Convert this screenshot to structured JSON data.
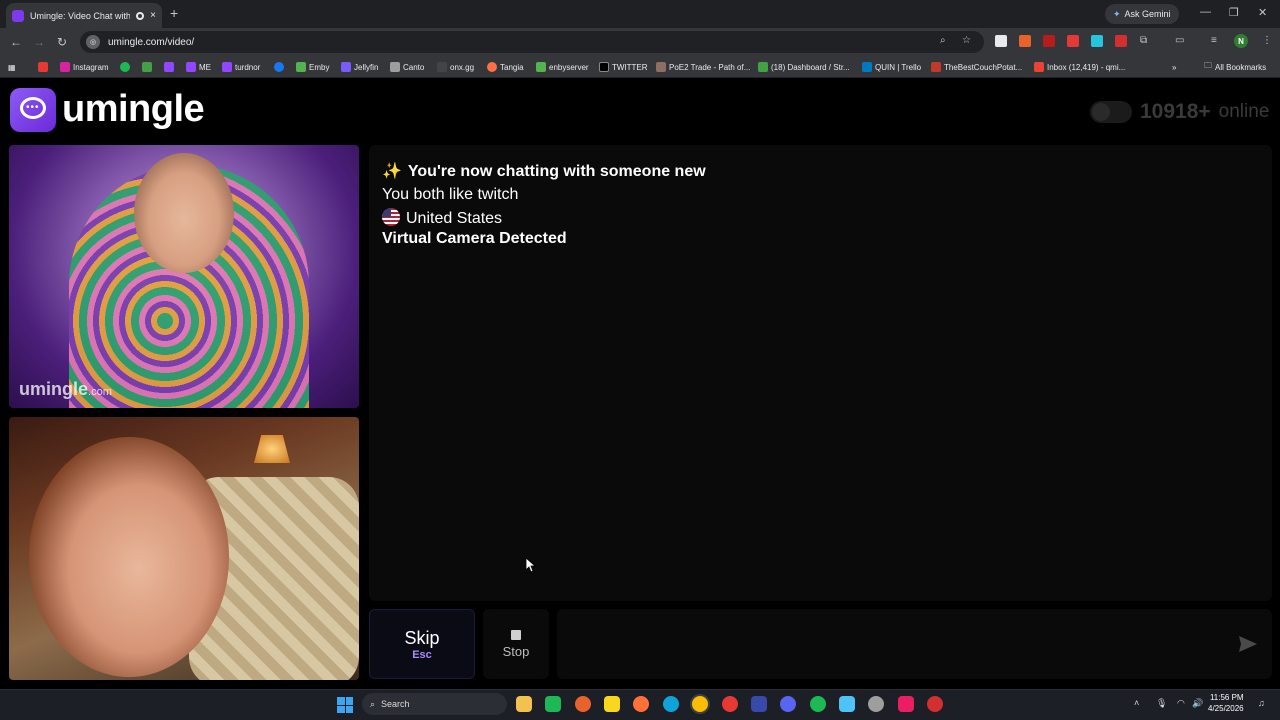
{
  "browser": {
    "tab_title": "Umingle: Video Chat with S",
    "tab_close": "×",
    "new_tab": "+",
    "ask_gemini": "Ask Gemini",
    "url": "umingle.com/video/",
    "bookmarks": [
      "Instagram",
      "ME",
      "turdnor",
      "Emby",
      "Jellyfin",
      "Canto",
      "onx.gg",
      "Tangia",
      "enbyserver",
      "TWITTER",
      "PoE2 Trade - Path of...",
      "(18) Dashboard / Str...",
      "QUIN | Trello",
      "TheBestCouchPotat...",
      "Inbox (12,419) - qmi..."
    ],
    "all_bookmarks": "All Bookmarks",
    "profile_initial": "N"
  },
  "site": {
    "logo_text": "umingle",
    "online_count": "10918+",
    "online_label": "online",
    "watermark_main": "umingle",
    "watermark_suffix": ".com"
  },
  "chat": {
    "messages": {
      "m1": "You're now chatting with someone new",
      "m2": "You both like twitch",
      "m3": "United States",
      "m4": "Virtual Camera Detected"
    },
    "sparkle": "✨",
    "input_placeholder": ""
  },
  "controls": {
    "skip_label": "Skip",
    "skip_key": "Esc",
    "stop_label": "Stop"
  },
  "taskbar": {
    "search_label": "Search",
    "time": "11:56 PM",
    "date": "4/25/2026"
  },
  "colors": {
    "brand": "#7c3aed",
    "background": "#000000",
    "panel": "#0a0a0a"
  }
}
